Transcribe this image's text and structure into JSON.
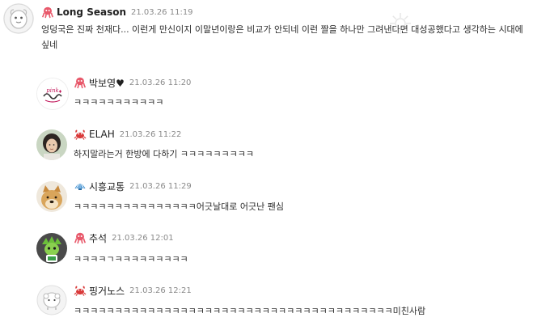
{
  "comments": [
    {
      "nickname": "Long Season",
      "timestamp": "21.03.26 11:19",
      "level_icon": "octopus-icon",
      "text_line1": "엉덩국은 진짜 천재다... 이런게 만신이지 이말년이랑은 비교가 안되네 이런 짤을 하나만 그려낸다면 대성공했다고 생각하는 시대에 이 정도 얘기하는 사이 줍 싫네",
      "text_line2": "싶네"
    },
    {
      "nickname": "박보영♥",
      "timestamp": "21.03.26 11:20",
      "level_icon": "octopus-icon",
      "text": "ㅋㅋㅋㅋㅋㅋㅋㅋㅋㅋㅋ"
    },
    {
      "nickname": "ELAH",
      "timestamp": "21.03.26 11:22",
      "level_icon": "crab-icon",
      "text": "하지말라는거 한방에 다하기 ㅋㅋㅋㅋㅋㅋㅋㅋㅋ"
    },
    {
      "nickname": "시흥교통",
      "timestamp": "21.03.26 11:29",
      "level_icon": "shell-icon",
      "text": "ㅋㅋㅋㅋㅋㅋㅋㅋㅋㅋㅋㅋㅋㅋㅋ어긋날대로 어긋난 팬심"
    },
    {
      "nickname": "추석",
      "timestamp": "21.03.26 12:01",
      "level_icon": "octopus-icon",
      "text": "ㅋㅋㅋㅋㄱㅋㅋㅋㅋㅋㅋㅋㅋㅋ"
    },
    {
      "nickname": "핑거노스",
      "timestamp": "21.03.26 12:21",
      "level_icon": "crab-icon",
      "text": "ㅋㅋㅋㅋㅋㅋㅋㅋㅋㅋㅋㅋㅋㅋㅋㅋㅋㅋㅋㅋㅋㅋㅋㅋㅋㅋㅋㅋㅋㅋㅋㅋㅋㅋㅋㅋㅋㅋㅋ미친사람"
    }
  ],
  "avatar_icons": [
    "default-avatar-icon",
    "bakboyoung-avatar",
    "elah-avatar",
    "doge-avatar",
    "green-character-avatar",
    "sheep-avatar"
  ],
  "colors": {
    "octopus": "#e8596b",
    "crab": "#d93a3a",
    "shell": "#3d8fd1",
    "timestamp": "#8a8a8a"
  }
}
